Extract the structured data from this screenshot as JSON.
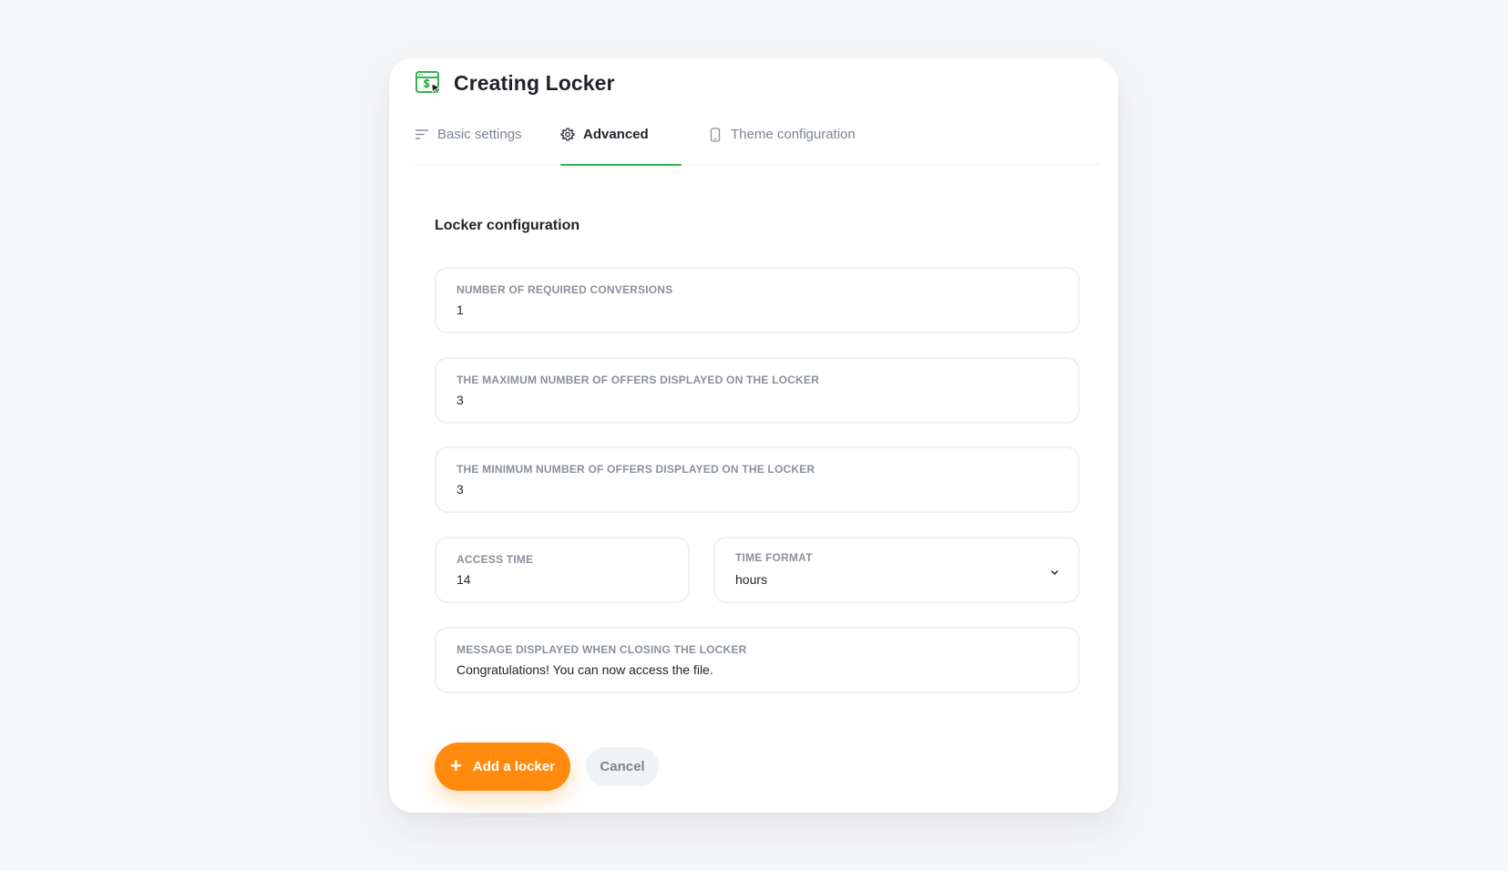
{
  "header": {
    "title": "Creating Locker",
    "icon": "browser-dollar-cursor-icon"
  },
  "tabs": [
    {
      "label": "Basic settings",
      "icon": "sort-lines-icon",
      "active": false
    },
    {
      "label": "Advanced",
      "icon": "gear-icon",
      "active": true
    },
    {
      "label": "Theme configuration",
      "icon": "mobile-phone-icon",
      "active": false
    }
  ],
  "section": {
    "title": "Locker configuration"
  },
  "fields": {
    "required_conversions": {
      "label": "NUMBER OF REQUIRED CONVERSIONS",
      "value": "1"
    },
    "max_offers": {
      "label": "THE MAXIMUM NUMBER OF OFFERS DISPLAYED ON THE LOCKER",
      "value": "3"
    },
    "min_offers": {
      "label": "THE MINIMUM NUMBER OF OFFERS DISPLAYED ON THE LOCKER",
      "value": "3"
    },
    "access_time": {
      "label": "ACCESS TIME",
      "value": "14"
    },
    "time_format": {
      "label": "TIME FORMAT",
      "value": "hours"
    },
    "closing_message": {
      "label": "MESSAGE DISPLAYED WHEN CLOSING THE LOCKER",
      "value": "Congratulations! You can now access the file."
    }
  },
  "actions": {
    "add_label": "Add a locker",
    "add_icon": "+",
    "cancel_label": "Cancel"
  },
  "colors": {
    "accent_green": "#34b24a",
    "primary_orange": "#ff8a0d",
    "background": "#f5f6f8"
  }
}
